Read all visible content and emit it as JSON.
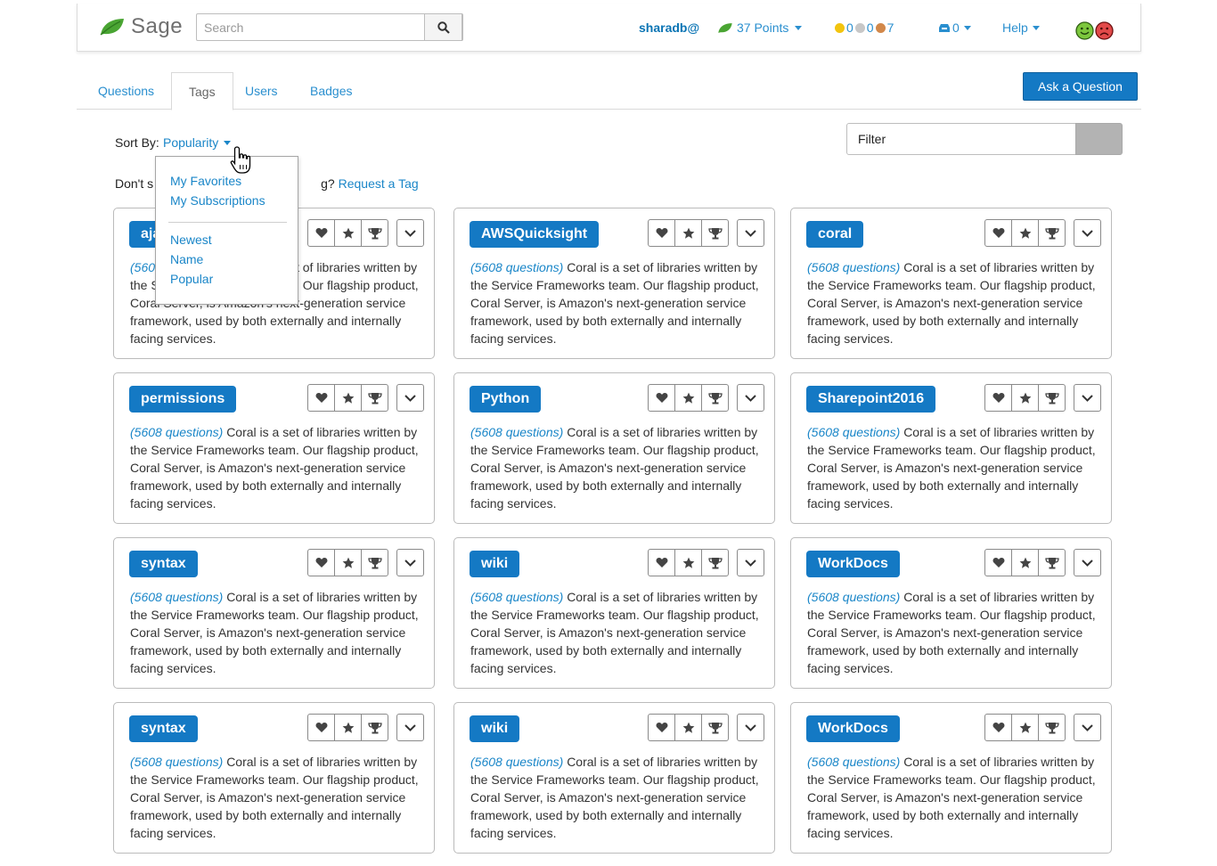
{
  "header": {
    "app_name": "Sage",
    "search_placeholder": "Search",
    "username": "sharadb@",
    "points": "37 Points",
    "medals": {
      "gold": "0",
      "silver": "0",
      "bronze": "7"
    },
    "inbox_count": "0",
    "help": "Help",
    "colors": {
      "leaf": "#4aa533",
      "link": "#2a8fcf",
      "gold": "#f2c40f",
      "silver": "#c7c7c7",
      "bronze": "#d2884a"
    }
  },
  "tabs": [
    {
      "label": "Questions"
    },
    {
      "label": "Tags",
      "active": true
    },
    {
      "label": "Users"
    },
    {
      "label": "Badges"
    }
  ],
  "ask_button": "Ask a Question",
  "sort": {
    "label": "Sort By:",
    "value": "Popularity"
  },
  "filter_placeholder": "Filter",
  "request_line": {
    "prefix": "Don't s",
    "middle": "g?",
    "link": "Request a Tag"
  },
  "sort_menu": {
    "items_top": [
      "My Favorites",
      "My Subscriptions"
    ],
    "items_bottom": [
      "Newest",
      "Name",
      "Popular"
    ]
  },
  "card_desc": {
    "count": "(5608 questions)",
    "text": "Coral is a set of libraries written by the Service Frameworks team. Our flagship product, Coral Server, is Amazon's next-generation service framework, used by both externally and internally facing services."
  },
  "cards": [
    {
      "tag": "ajax"
    },
    {
      "tag": "AWSQuicksight"
    },
    {
      "tag": "coral"
    },
    {
      "tag": "permissions"
    },
    {
      "tag": "Python"
    },
    {
      "tag": "Sharepoint2016"
    },
    {
      "tag": "syntax"
    },
    {
      "tag": "wiki"
    },
    {
      "tag": "WorkDocs"
    },
    {
      "tag": "syntax"
    },
    {
      "tag": "wiki"
    },
    {
      "tag": "WorkDocs"
    }
  ]
}
